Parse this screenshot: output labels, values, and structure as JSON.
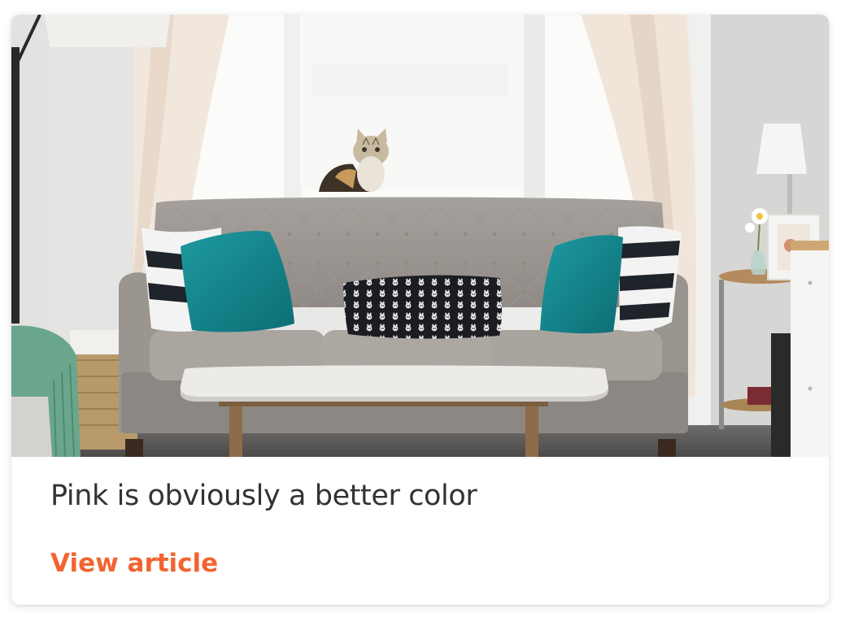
{
  "card": {
    "image_alt": "Living room with a grey tufted sofa, teal and patterned pillows, a cat on the window sill and a white coffee table",
    "title": "Pink is obviously a better color",
    "link_label": "View article"
  },
  "colors": {
    "accent": "#f26430",
    "title_text": "#333333",
    "card_background": "#ffffff"
  }
}
